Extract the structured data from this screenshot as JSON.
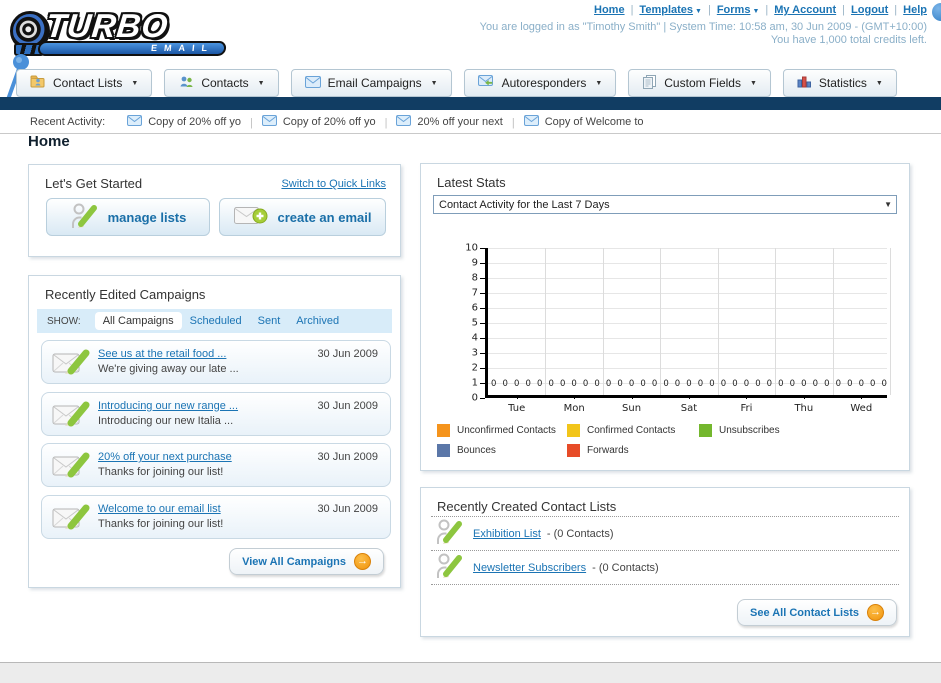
{
  "brand": {
    "name_top": "TURBO",
    "name_bottom": "EMAIL"
  },
  "header": {
    "links": [
      {
        "label": "Home",
        "dropdown": false
      },
      {
        "label": "Templates",
        "dropdown": true
      },
      {
        "label": "Forms",
        "dropdown": true
      },
      {
        "label": "My Account",
        "dropdown": false
      },
      {
        "label": "Logout",
        "dropdown": false
      },
      {
        "label": "Help",
        "dropdown": false
      }
    ],
    "login_line": "You are logged in as \"Timothy Smith\" | System Time: 10:58 am, 30 Jun 2009 - (GMT+10:00)",
    "credits_line": "You have 1,000 total credits left."
  },
  "nav": {
    "tabs": [
      {
        "label": "Contact Lists",
        "icon": "contact-lists-icon"
      },
      {
        "label": "Contacts",
        "icon": "contacts-icon"
      },
      {
        "label": "Email Campaigns",
        "icon": "email-campaigns-icon"
      },
      {
        "label": "Autoresponders",
        "icon": "autoresponders-icon"
      },
      {
        "label": "Custom Fields",
        "icon": "custom-fields-icon"
      },
      {
        "label": "Statistics",
        "icon": "statistics-icon"
      }
    ]
  },
  "recent_activity": {
    "label": "Recent Activity:",
    "items": [
      "Copy of 20% off yo",
      "Copy of 20% off yo",
      "20% off your next",
      "Copy of Welcome to"
    ]
  },
  "page_title": "Home",
  "get_started": {
    "title": "Let's Get Started",
    "switch_link": "Switch to Quick Links",
    "buttons": [
      {
        "label": "manage lists",
        "icon": "person-pencil-icon"
      },
      {
        "label": "create an email",
        "icon": "envelope-plus-icon"
      }
    ]
  },
  "campaigns": {
    "title": "Recently Edited Campaigns",
    "show_label": "SHOW:",
    "tabs": [
      "All Campaigns",
      "Scheduled",
      "Sent",
      "Archived"
    ],
    "active_tab": "All Campaigns",
    "items": [
      {
        "title": "See us at the retail food ...",
        "subtitle": "We're giving away our late ...",
        "date": "30 Jun 2009"
      },
      {
        "title": "Introducing our new range ...",
        "subtitle": "Introducing our new Italia ...",
        "date": "30 Jun 2009"
      },
      {
        "title": "20% off your next purchase",
        "subtitle": "Thanks for joining our list!",
        "date": "30 Jun 2009"
      },
      {
        "title": "Welcome to our email list",
        "subtitle": "Thanks for joining our list!",
        "date": "30 Jun 2009"
      }
    ],
    "view_all_label": "View All Campaigns"
  },
  "stats": {
    "title": "Latest Stats",
    "dropdown_value": "Contact Activity for the Last 7 Days",
    "chart_data": {
      "type": "bar",
      "title": "Contact Activity for the Last 7 Days",
      "categories": [
        "Tue",
        "Mon",
        "Sun",
        "Sat",
        "Fri",
        "Thu",
        "Wed"
      ],
      "series": [
        {
          "name": "Unconfirmed Contacts",
          "color": "#f5941d",
          "values": [
            0,
            0,
            0,
            0,
            0,
            0,
            0
          ]
        },
        {
          "name": "Confirmed Contacts",
          "color": "#f2c51a",
          "values": [
            0,
            0,
            0,
            0,
            0,
            0,
            0
          ]
        },
        {
          "name": "Unsubscribes",
          "color": "#74b72e",
          "values": [
            0,
            0,
            0,
            0,
            0,
            0,
            0
          ]
        },
        {
          "name": "Bounces",
          "color": "#5b77a8",
          "values": [
            0,
            0,
            0,
            0,
            0,
            0,
            0
          ]
        },
        {
          "name": "Forwards",
          "color": "#e74c28",
          "values": [
            0,
            0,
            0,
            0,
            0,
            0,
            0
          ]
        }
      ],
      "ylim": [
        0,
        10
      ],
      "yticks": [
        0,
        1,
        2,
        3,
        4,
        5,
        6,
        7,
        8,
        9,
        10
      ],
      "grid": true,
      "legend_position": "bottom",
      "data_labels": "0"
    }
  },
  "contact_lists": {
    "title": "Recently Created Contact Lists",
    "items": [
      {
        "name": "Exhibition List",
        "suffix": "- (0 Contacts)",
        "icon": "person-pencil-icon"
      },
      {
        "name": "Newsletter Subscribers",
        "suffix": "- (0 Contacts)",
        "icon": "person-pencil-icon"
      }
    ],
    "see_all_label": "See All Contact Lists"
  }
}
